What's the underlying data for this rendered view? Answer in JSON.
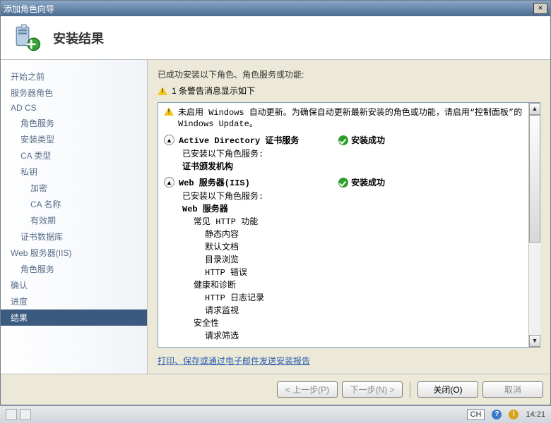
{
  "titlebar": {
    "text": "添加角色向导"
  },
  "header": {
    "title": "安装结果"
  },
  "sidebar": {
    "items": [
      {
        "label": "开始之前",
        "level": 1
      },
      {
        "label": "服务器角色",
        "level": 1
      },
      {
        "label": "AD CS",
        "level": 1
      },
      {
        "label": "角色服务",
        "level": 2
      },
      {
        "label": "安装类型",
        "level": 2
      },
      {
        "label": "CA 类型",
        "level": 2
      },
      {
        "label": "私钥",
        "level": 2
      },
      {
        "label": "加密",
        "level": 3
      },
      {
        "label": "CA 名称",
        "level": 3
      },
      {
        "label": "有效期",
        "level": 3
      },
      {
        "label": "证书数据库",
        "level": 2
      },
      {
        "label": "Web 服务器(IIS)",
        "level": 1
      },
      {
        "label": "角色服务",
        "level": 2
      },
      {
        "label": "确认",
        "level": 1
      },
      {
        "label": "进度",
        "level": 1
      },
      {
        "label": "结果",
        "level": 1,
        "selected": true
      }
    ]
  },
  "main": {
    "intro": "已成功安装以下角色、角色服务或功能:",
    "warning_summary": "1 条警告消息显示如下",
    "update_note": "未启用 Windows 自动更新。为确保自动更新最新安装的角色或功能，请启用“控制面板”的 Windows Update。",
    "sections": [
      {
        "title": "Active Directory 证书服务",
        "status": "安装成功",
        "sublabel": "已安装以下角色服务:",
        "items": [
          {
            "text": "证书颁发机构",
            "level": 1,
            "bold": true
          }
        ]
      },
      {
        "title": "Web 服务器(IIS)",
        "status": "安装成功",
        "sublabel": "已安装以下角色服务:",
        "items": [
          {
            "text": "Web 服务器",
            "level": 1,
            "bold": true
          },
          {
            "text": "常见 HTTP 功能",
            "level": 2
          },
          {
            "text": "静态内容",
            "level": 3
          },
          {
            "text": "默认文档",
            "level": 3
          },
          {
            "text": "目录浏览",
            "level": 3
          },
          {
            "text": "HTTP 错误",
            "level": 3
          },
          {
            "text": "健康和诊断",
            "level": 2
          },
          {
            "text": "HTTP 日志记录",
            "level": 3
          },
          {
            "text": "请求监视",
            "level": 3
          },
          {
            "text": "安全性",
            "level": 2
          },
          {
            "text": "请求筛选",
            "level": 3
          }
        ]
      }
    ],
    "report_link": "打印、保存或通过电子邮件发送安装报告"
  },
  "footer": {
    "back": "< 上一步(P)",
    "next": "下一步(N) >",
    "close": "关闭(O)",
    "cancel": "取消"
  },
  "taskbar": {
    "lang": "CH",
    "time": "14:21"
  },
  "status_ok_glyph": "◎"
}
